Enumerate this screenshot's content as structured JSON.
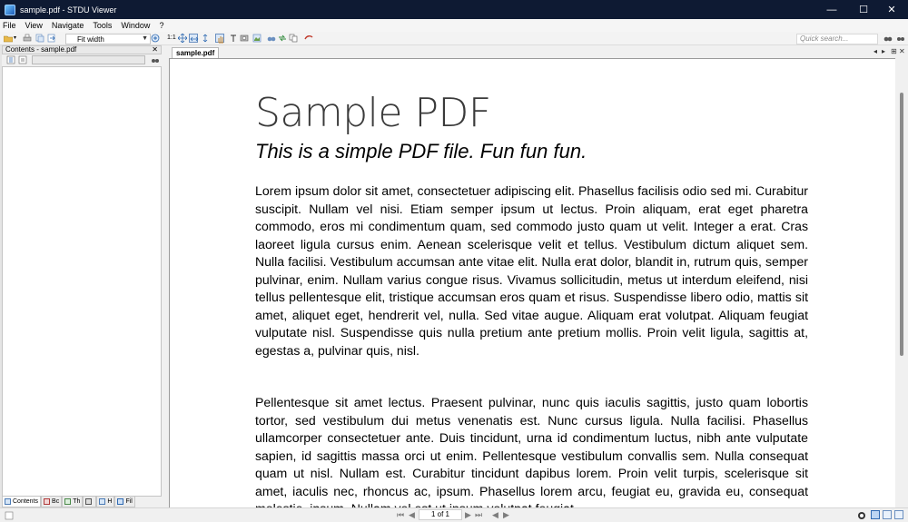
{
  "window": {
    "title": "sample.pdf - STDU Viewer",
    "minimize": "—",
    "maximize": "☐",
    "close": "✕"
  },
  "menu": [
    "File",
    "View",
    "Navigate",
    "Tools",
    "Window",
    "?"
  ],
  "toolbar": {
    "zoom_mode": "Fit width",
    "actual_size_label": "1:1",
    "quick_search_placeholder": "Quick search..."
  },
  "sidebar": {
    "panel_title": "Contents - sample.pdf",
    "close_glyph": "✕",
    "tabs": [
      "Contents",
      "Bc",
      "Th",
      "",
      "H",
      "Fil"
    ]
  },
  "document_tab": {
    "label": "sample.pdf"
  },
  "document": {
    "title": "Sample PDF",
    "subtitle": "This is a simple PDF file. Fun fun fun.",
    "paragraphs": [
      "Lorem ipsum dolor sit amet, consectetuer adipiscing elit. Phasellus facilisis odio sed mi. Curabitur suscipit. Nullam vel nisi. Etiam semper ipsum ut lectus. Proin aliquam, erat eget pharetra commodo, eros mi condimentum quam, sed commodo justo quam ut velit. Integer a erat. Cras laoreet ligula cursus enim. Aenean scelerisque velit et tellus. Vestibulum dictum aliquet sem. Nulla facilisi. Vestibulum accumsan ante vitae elit. Nulla erat dolor, blandit in, rutrum quis, semper pulvinar, enim. Nullam varius congue risus. Vivamus sollicitudin, metus ut interdum eleifend, nisi tellus pellentesque elit, tristique accumsan eros quam et risus. Suspendisse libero odio, mattis sit amet, aliquet eget, hendrerit vel, nulla. Sed vitae augue. Aliquam erat volutpat. Aliquam feugiat vulputate nisl. Suspendisse quis nulla pretium ante pretium mollis. Proin velit ligula, sagittis at, egestas a, pulvinar quis, nisl.",
      "Pellentesque sit amet lectus. Praesent pulvinar, nunc quis iaculis sagittis, justo quam lobortis tortor, sed vestibulum dui metus venenatis est. Nunc cursus ligula. Nulla facilisi. Phasellus ullamcorper consectetuer ante. Duis tincidunt, urna id condimentum luctus, nibh ante vulputate sapien, id sagittis massa orci ut enim. Pellentesque vestibulum convallis sem. Nulla consequat quam ut nisl. Nullam est. Curabitur tincidunt dapibus lorem. Proin velit turpis, scelerisque sit amet, iaculis nec, rhoncus ac, ipsum. Phasellus lorem arcu, feugiat eu, gravida eu, consequat molestie, ipsum. Nullam vel est ut ipsum volutpat feugiat."
    ]
  },
  "status": {
    "page_indicator": "1 of 1",
    "first": "⏮",
    "prev": "◀",
    "next": "▶",
    "last": "⏭",
    "back": "◀",
    "forward": "▶"
  },
  "colors": {
    "titlebar": "#0e1a33",
    "accent": "#2f6ab2"
  }
}
